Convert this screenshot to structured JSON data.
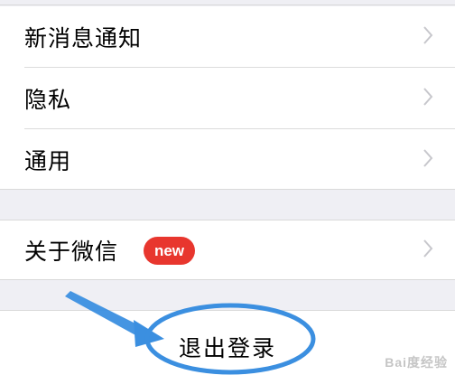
{
  "settings": {
    "rows": [
      {
        "label": "新消息通知"
      },
      {
        "label": "隐私"
      },
      {
        "label": "通用"
      }
    ],
    "about": {
      "label": "关于微信",
      "badge": "new"
    },
    "logout": {
      "label": "退出登录"
    }
  },
  "icons": {
    "chevron": "chevron-right-icon"
  },
  "colors": {
    "background": "#efeff4",
    "badge": "#e8362e",
    "annotation": "#3b8fe0"
  },
  "watermark": {
    "text": "Bai度经验"
  }
}
